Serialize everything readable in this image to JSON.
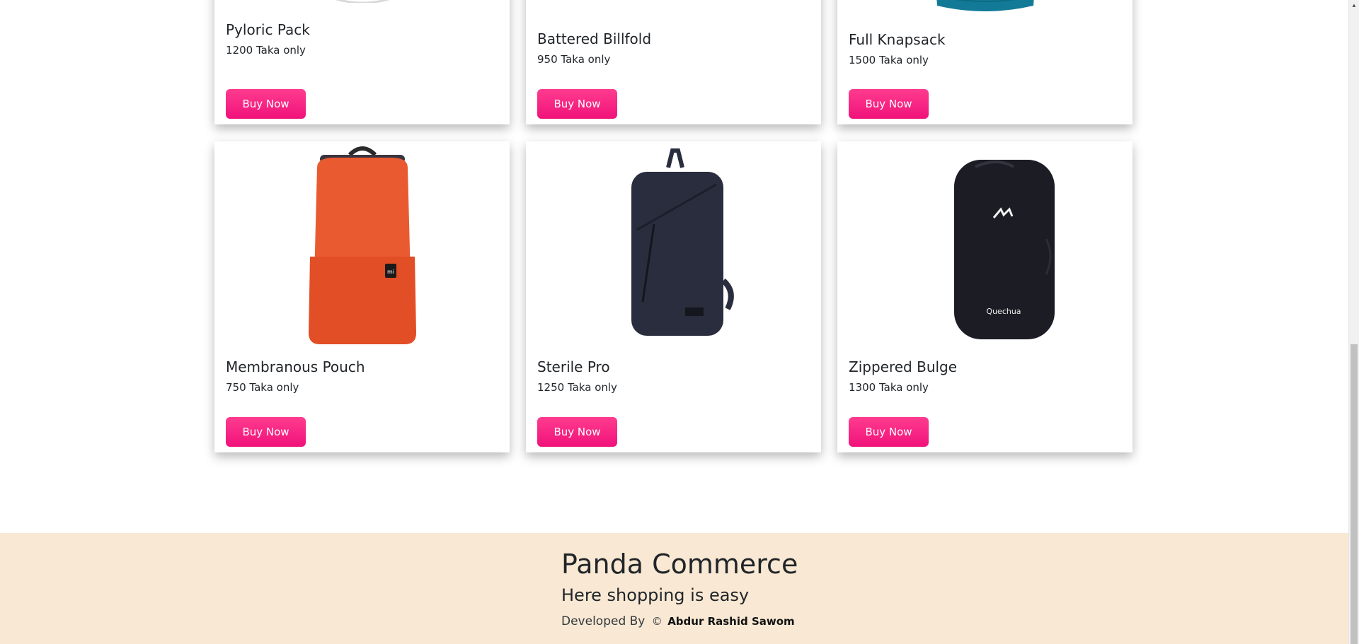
{
  "products_top_row": [
    {
      "name": "Pyloric Pack",
      "price": "1200 Taka only",
      "button": "Buy Now"
    },
    {
      "name": "Battered Billfold",
      "price": "950 Taka only",
      "button": "Buy Now"
    },
    {
      "name": "Full Knapsack",
      "price": "1500 Taka only",
      "button": "Buy Now"
    }
  ],
  "products_bottom_row": [
    {
      "name": "Membranous Pouch",
      "price": "750 Taka only",
      "button": "Buy Now",
      "image_color": "#ea5a30"
    },
    {
      "name": "Sterile Pro",
      "price": "1250 Taka only",
      "button": "Buy Now",
      "image_color": "#2a2d3d"
    },
    {
      "name": "Zippered Bulge",
      "price": "1300 Taka only",
      "button": "Buy Now",
      "image_color": "#1c1c24"
    }
  ],
  "footer": {
    "brand": "Panda Commerce",
    "tagline": "Here shopping is easy",
    "credit_prefix": "Developed By",
    "copyright_symbol": "©",
    "author": "Abdur Rashid Sawom"
  },
  "colors": {
    "buy_button": "#f0127a",
    "footer_bg": "#f9e9d4",
    "top_right_bag": "#127a96"
  },
  "icons": {
    "scroll_up": "triangle-up-icon"
  }
}
